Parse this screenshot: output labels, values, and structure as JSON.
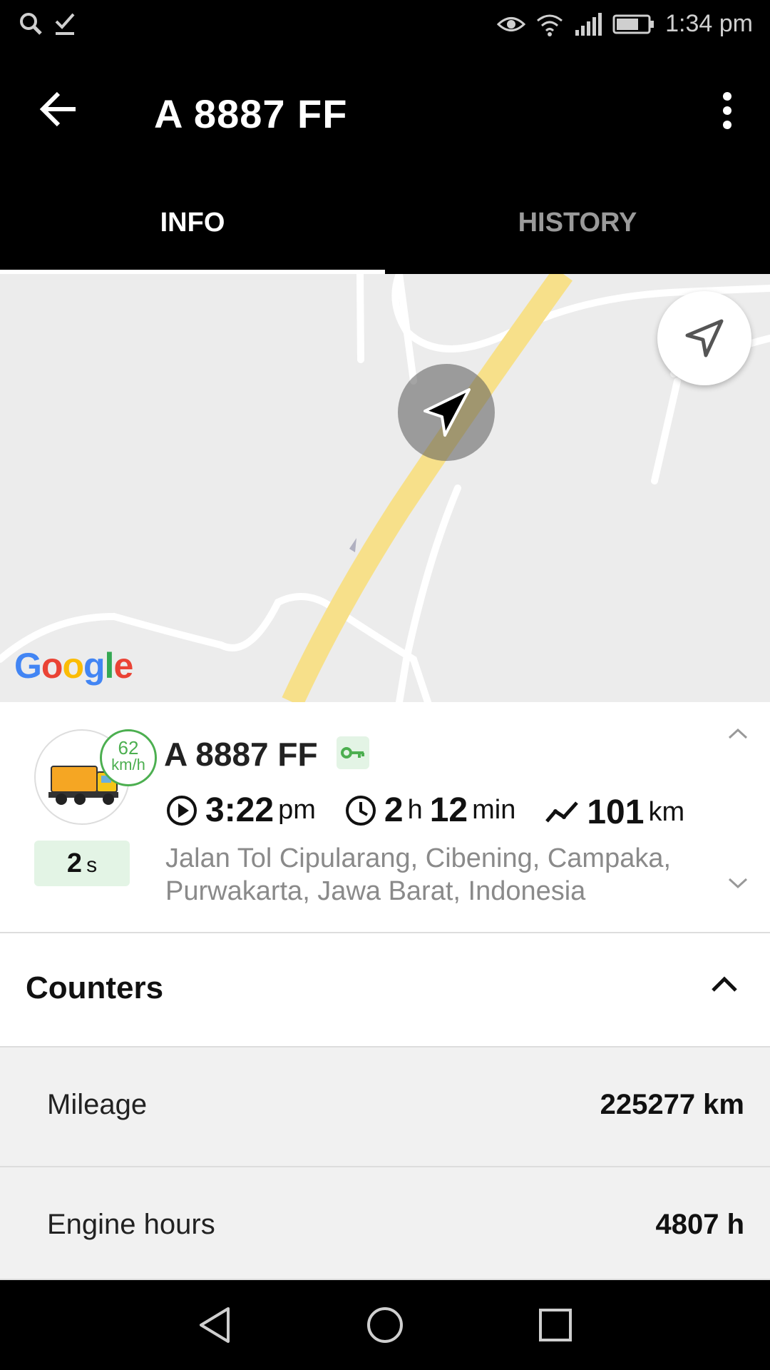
{
  "status_bar": {
    "time": "1:34 pm",
    "icons": [
      "search-icon",
      "checkmark-icon",
      "eye-icon",
      "wifi-icon",
      "signal-icon",
      "battery-icon"
    ]
  },
  "app_bar": {
    "title": "A 8887 FF",
    "back_icon": "arrow-back-icon",
    "menu_icon": "more-vert-icon"
  },
  "tabs": [
    {
      "label": "INFO",
      "active": true
    },
    {
      "label": "HISTORY",
      "active": false
    }
  ],
  "map": {
    "attribution": "Google",
    "locate_icon": "navigation-arrow-icon",
    "marker_icon": "vehicle-heading-arrow-icon"
  },
  "unit": {
    "name": "A 8887 FF",
    "speed_value": "62",
    "speed_unit": "km/h",
    "age_value": "2",
    "age_unit": "s",
    "ignition_icon": "key-icon",
    "time_value": "3:22",
    "time_unit": "pm",
    "duration_hours": "2",
    "duration_hours_unit": "h",
    "duration_minutes": "12",
    "duration_minutes_unit": "min",
    "distance_value": "101",
    "distance_unit": "km",
    "address": "Jalan Tol Cipularang, Cibening, Campaka, Purwakarta, Jawa Barat, Indonesia",
    "colors": {
      "speed": "#4caf50",
      "badge_bg": "#e3f4e5",
      "route": "#f7e08a"
    }
  },
  "counters": {
    "title": "Counters",
    "rows": [
      {
        "label": "Mileage",
        "value": "225277 km"
      },
      {
        "label": "Engine hours",
        "value": "4807 h"
      }
    ]
  },
  "nav_bar": {
    "icons": [
      "back-triangle-icon",
      "home-circle-icon",
      "recents-square-icon"
    ]
  }
}
